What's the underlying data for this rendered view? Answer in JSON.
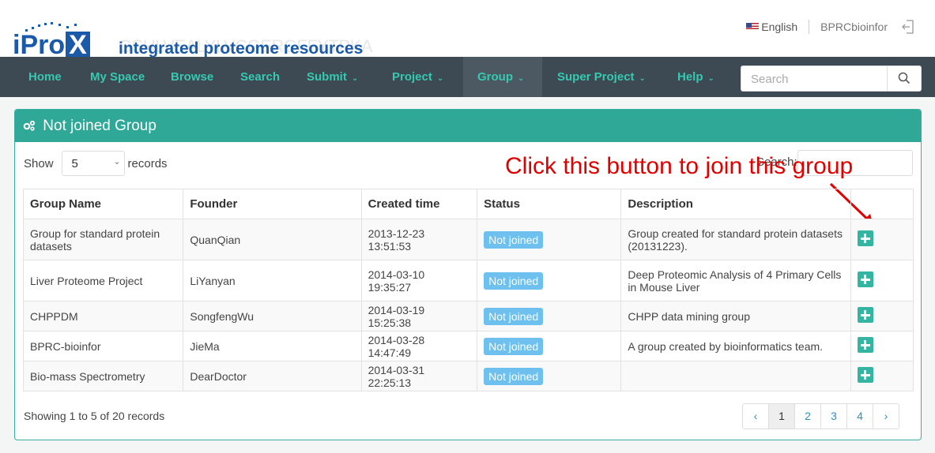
{
  "brand": {
    "name": "iPro",
    "name_x": "X",
    "tagline": "integrated proteome resources",
    "bg_sequence": "GSHLVEALYLVCGERGFFYTPKA"
  },
  "topbar": {
    "language": "English",
    "user": "BPRCbioinfor"
  },
  "nav": {
    "items": [
      {
        "label": "Home"
      },
      {
        "label": "My Space"
      },
      {
        "label": "Browse"
      },
      {
        "label": "Search"
      },
      {
        "label": "Submit"
      },
      {
        "label": "Project"
      },
      {
        "label": "Group"
      },
      {
        "label": "Super Project"
      },
      {
        "label": "Help"
      }
    ],
    "search_placeholder": "Search"
  },
  "panel": {
    "title": "Not joined Group",
    "show_label": "Show",
    "records_label": "records",
    "page_size": "5",
    "search_label": "Search:",
    "annotation": "Click this button  to join this group"
  },
  "table": {
    "headers": [
      "Group Name",
      "Founder",
      "Created time",
      "Status",
      "Description"
    ],
    "rows": [
      {
        "name": "Group for standard protein datasets",
        "founder": "QuanQian",
        "created": "2013-12-23 13:51:53",
        "status": "Not joined",
        "desc": "Group created for standard protein datasets (20131223)."
      },
      {
        "name": "Liver Proteome Project",
        "founder": "LiYanyan",
        "created": "2014-03-10 19:35:27",
        "status": "Not joined",
        "desc": "Deep Proteomic Analysis of 4 Primary Cells in Mouse Liver"
      },
      {
        "name": "CHPPDM",
        "founder": "SongfengWu",
        "created": "2014-03-19 15:25:38",
        "status": "Not joined",
        "desc": "CHPP data mining group"
      },
      {
        "name": "BPRC-bioinfor",
        "founder": "JieMa",
        "created": "2014-03-28 14:47:49",
        "status": "Not joined",
        "desc": "A group created by bioinformatics team."
      },
      {
        "name": "Bio-mass Spectrometry",
        "founder": "DearDoctor",
        "created": "2014-03-31 22:25:13",
        "status": "Not joined",
        "desc": ""
      }
    ]
  },
  "footer": {
    "info": "Showing 1 to 5 of 20 records",
    "pages": [
      "1",
      "2",
      "3",
      "4"
    ],
    "prev": "‹",
    "next": "›"
  }
}
